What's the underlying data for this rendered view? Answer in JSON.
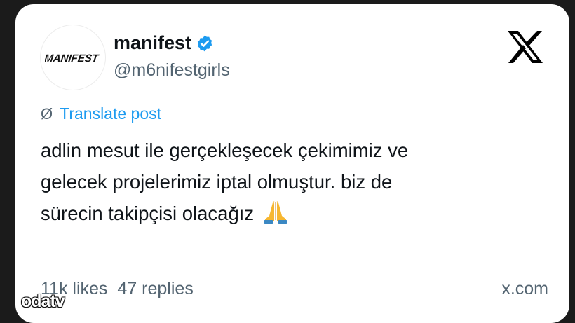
{
  "account": {
    "avatar_text": "MANIFEST",
    "display_name": "manifest",
    "handle": "@m6nifestgirls",
    "verified": true,
    "verified_color": "#1d9bf0"
  },
  "header": {
    "logo_icon": "x-logo-icon"
  },
  "post": {
    "translate_label": "Translate post",
    "translate_icon": "globe-icon",
    "lines": [
      "adlin mesut ile gerçekleşecek çekimimiz ve",
      "gelecek projelerimiz iptal olmuştur. biz de",
      "sürecin takipçisi olacağız"
    ],
    "emoji_icon": "folded-hands-icon"
  },
  "footer": {
    "likes": "11k likes",
    "replies": "47 replies",
    "source": "x.com"
  },
  "watermark": {
    "text": "odatv"
  },
  "colors": {
    "link": "#1d9bf0",
    "text": "#0f1419",
    "muted": "#536471",
    "frame": "#1b1b1b"
  }
}
